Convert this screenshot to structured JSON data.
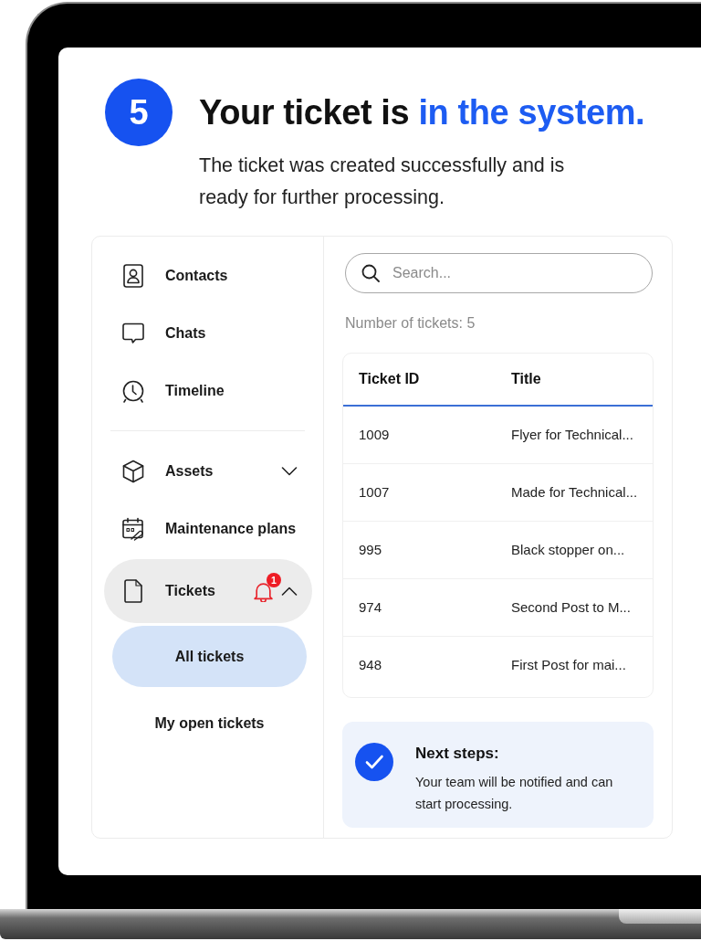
{
  "header": {
    "step": "5",
    "heading": "Your ticket is",
    "heading_highlight": "in the system.",
    "subtitle": "The ticket was created successfully and is ready for further processing."
  },
  "sidebar": {
    "sections": [
      {
        "items": [
          {
            "label": "Contacts",
            "selected": false
          },
          {
            "label": "Chats",
            "selected": false
          },
          {
            "label": "Timeline",
            "selected": false
          }
        ]
      },
      {
        "items": [
          {
            "label": "Assets",
            "selected": false,
            "expanded": false
          },
          {
            "label": "Maintenance plans",
            "selected": false
          },
          {
            "label": "Tickets",
            "selected": true,
            "expanded": true,
            "badge": "1",
            "children": [
              {
                "label": "All tickets",
                "selected": true
              },
              {
                "label": "My open tickets",
                "selected": false
              }
            ]
          }
        ]
      }
    ]
  },
  "search": {
    "placeholder": "Search..."
  },
  "ticket_count": "Number of tickets: 5",
  "table": {
    "columns": [
      "Ticket ID",
      "Title"
    ],
    "rows": [
      [
        "1009",
        "Flyer for Technical..."
      ],
      [
        "1007",
        "Made for Technical..."
      ],
      [
        "995",
        "Black stopper on..."
      ],
      [
        "974",
        "Second Post to M..."
      ],
      [
        "948",
        "First Post for mai..."
      ]
    ]
  },
  "next_steps": {
    "title": "Next steps:",
    "text": "Your team will be notified and can start processing."
  }
}
